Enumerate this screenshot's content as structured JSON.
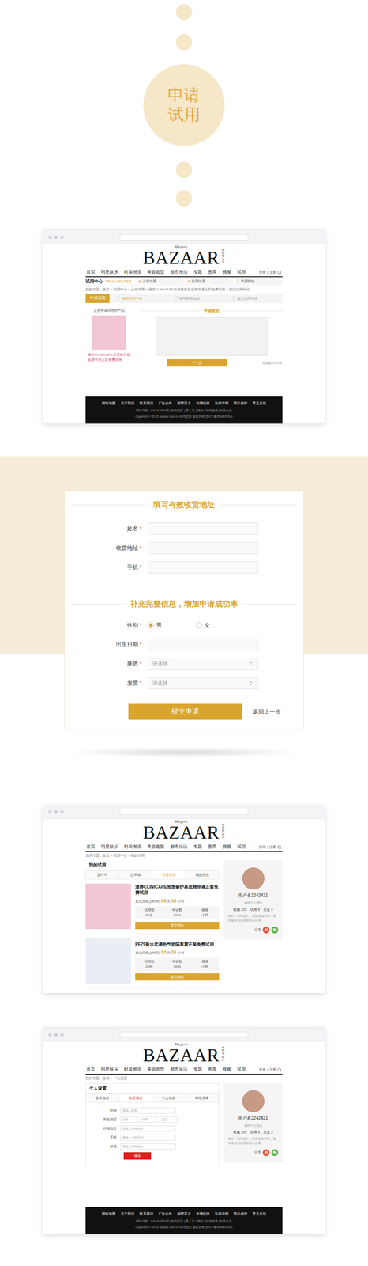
{
  "intro": {
    "title": "申请试用"
  },
  "site": {
    "logo": {
      "tagline": "Harper's",
      "brand": "BAZAAR",
      "domain": "COM.CN"
    },
    "nav": [
      "首页",
      "明星娱乐",
      "时装潮流",
      "美容造型",
      "都市乐活",
      "专题",
      "图库",
      "视频",
      "试用"
    ],
    "account": [
      "登录",
      "|",
      "注册"
    ],
    "footer": {
      "links": [
        "网站地图",
        "关于我们",
        "联系我们",
        "广告合作",
        "诚聘英才",
        "友情链接",
        "法律声明",
        "隐私保护",
        "意见反馈"
      ],
      "lines": [
        "网站导航：BAZAAR中国 | 时尚芭莎 | 男人装 | 瑞丽 | 时尚健康 | 时尚先生",
        "Copyright © 2015 bazaar.com.cn 时尚芭莎 版权所有 京ICP备05048265号"
      ]
    }
  },
  "apply_page": {
    "trial_center": {
      "title": "试用中心",
      "subtitle": "TRIAL CENTER",
      "links": [
        "正在试用",
        "往期试用",
        "试用报告"
      ]
    },
    "breadcrumb": "您的位置：首页 > 试用中心 > 正在试用 > 漫婷CLINICARE发质修护基底精华液正装免费试用 > 提交试用申请",
    "steps": {
      "title": "申请试用",
      "items": [
        {
          "number": "1",
          "label": "填写试用申请",
          "selected": true
        },
        {
          "number": "2",
          "label": "填写联系信息",
          "selected": false
        },
        {
          "number": "3",
          "label": "提交试用申请",
          "selected": false
        }
      ]
    },
    "product": {
      "heading": "正在申请试用的产品",
      "name": "漫婷CLINICARE发质修护基底精华液正装免费试用",
      "color": "#f2c6d2"
    },
    "declaration": {
      "title": "申请宣言",
      "text": "",
      "button": "下一步",
      "counter": "还能输入200字"
    }
  },
  "address_form": {
    "required_mark": "*",
    "sections": [
      {
        "title": "填写有效收货地址",
        "fields": [
          {
            "kind": "input",
            "label": "姓名",
            "required": true,
            "value": ""
          },
          {
            "kind": "input",
            "label": "收货地址",
            "required": true,
            "value": ""
          },
          {
            "kind": "input",
            "label": "手机",
            "required": true,
            "value": ""
          }
        ]
      },
      {
        "title": "补充完整信息，增加申请成功率",
        "fields": [
          {
            "kind": "radio",
            "label": "性别",
            "required": true,
            "options": [
              {
                "label": "男",
                "selected": true
              },
              {
                "label": "女",
                "selected": false
              }
            ]
          },
          {
            "kind": "input",
            "label": "出生日期",
            "required": true,
            "value": ""
          },
          {
            "kind": "select",
            "label": "肤质",
            "required": true,
            "placeholder": "请选择"
          },
          {
            "kind": "select",
            "label": "发质",
            "required": true,
            "placeholder": "请选择"
          }
        ]
      }
    ],
    "submit": "提交申请",
    "back": "返回上一步"
  },
  "my_trial": {
    "breadcrumb": "您的位置：首页 > 试用中心 > 我的试用",
    "title": "我的试用",
    "tabs": [
      {
        "label": "进行中",
        "selected": false
      },
      {
        "label": "已申请",
        "selected": false
      },
      {
        "label": "待提报告",
        "selected": true
      },
      {
        "label": "我的报告",
        "selected": false
      }
    ],
    "items": [
      {
        "name": "漫婷CLINICARE发质修护基底精华液正装免费试用",
        "color": "#f2c6d2",
        "countdown": {
          "label": "离试用截止时间:",
          "days": "04",
          "days_unit": "天",
          "hours": "06",
          "hours_unit": "小时"
        },
        "stats": [
          {
            "label": "试用数",
            "value": "20份"
          },
          {
            "label": "申请数",
            "value": "9999"
          },
          {
            "label": "规格",
            "value": "小样"
          }
        ],
        "button": "提交报告"
      },
      {
        "name": "PF79新水柔调色气垫隔离霜正装免费试用",
        "color": "#e9eef4",
        "countdown": {
          "label": "离试用截止时间:",
          "days": "04",
          "days_unit": "天",
          "hours": "06",
          "hours_unit": "小时"
        },
        "stats": [
          {
            "label": "试用数",
            "value": "20份"
          },
          {
            "label": "申请数",
            "value": "9999"
          },
          {
            "label": "规格",
            "value": "小样"
          }
        ],
        "button": "提交报告"
      }
    ]
  },
  "profile": {
    "name": "用户名3242421",
    "edit": "编辑个人信息",
    "stats": [
      {
        "label": "收藏",
        "value": "225"
      },
      {
        "label": "试用",
        "value": "5"
      },
      {
        "label": "关注",
        "value": "2"
      }
    ],
    "bio": "简介：时尚达人，热爱美妆护肤，期待更多的试用体验与分享。",
    "share": "分享"
  },
  "settings": {
    "breadcrumb": "您的位置：首页 > 个人设置",
    "title": "个人设置",
    "tabs": [
      {
        "label": "基本信息",
        "selected": false
      },
      {
        "label": "收货地址",
        "selected": true
      },
      {
        "label": "个人信息",
        "selected": false
      },
      {
        "label": "修改头像",
        "selected": false
      }
    ],
    "fields": [
      {
        "kind": "input",
        "label": "昵称",
        "placeholder": "请输入昵称"
      },
      {
        "kind": "selects",
        "label": "所在地区",
        "options": [
          "省份",
          "城市",
          "区县"
        ]
      },
      {
        "kind": "input",
        "label": "详细地址",
        "placeholder": "请输入详细地址"
      },
      {
        "kind": "input",
        "label": "手机",
        "placeholder": "请输入手机号码"
      },
      {
        "kind": "input",
        "label": "邮箱",
        "placeholder": "请输入邮箱地址"
      }
    ],
    "button": "保存"
  }
}
